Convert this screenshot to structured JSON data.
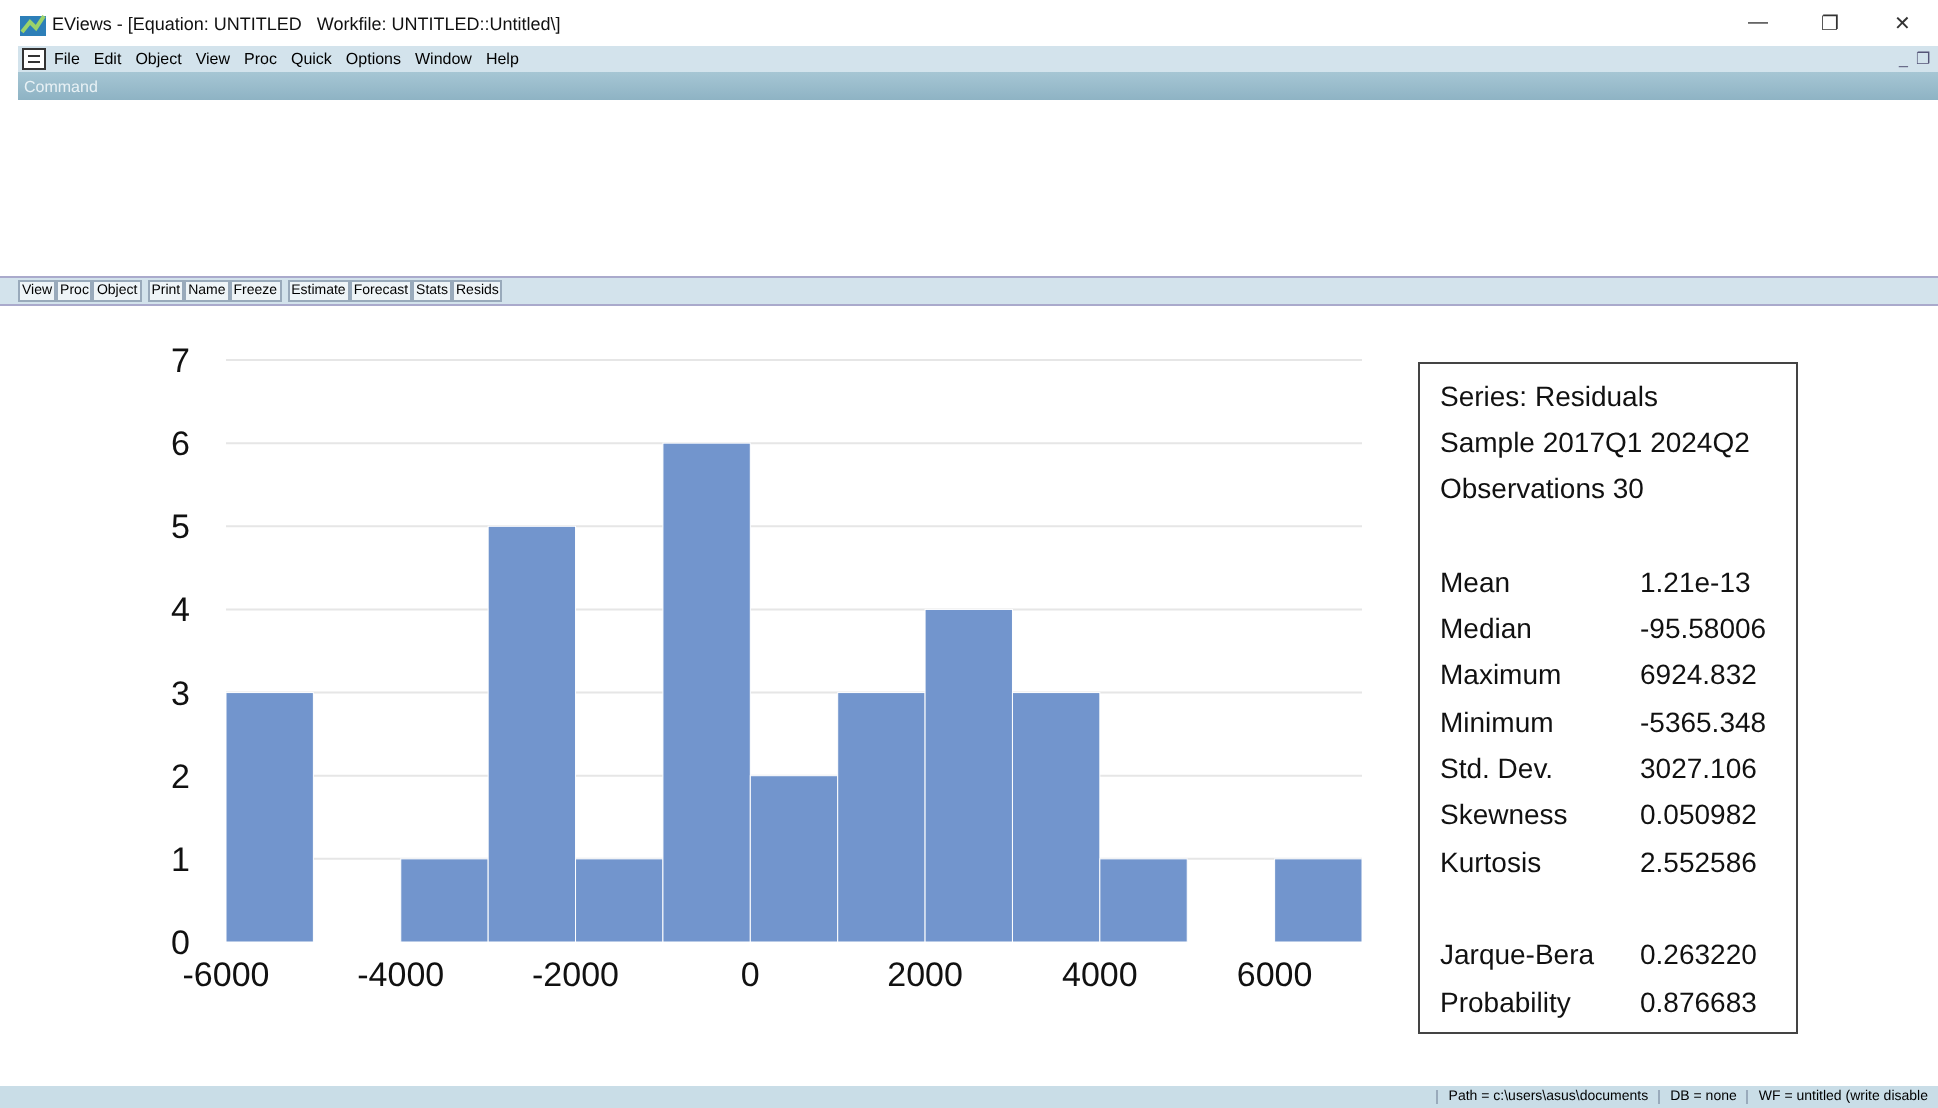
{
  "window": {
    "title": "EViews - [Equation: UNTITLED   Workfile: UNTITLED::Untitled\\]",
    "controls": [
      "—",
      "❐",
      "✕"
    ]
  },
  "menu": {
    "items": [
      "File",
      "Edit",
      "Object",
      "View",
      "Proc",
      "Quick",
      "Options",
      "Window",
      "Help"
    ],
    "mdi_controls": [
      "_",
      "❐"
    ]
  },
  "command": {
    "label": "Command"
  },
  "toolbar": {
    "groups": [
      [
        "View",
        "Proc",
        "Object"
      ],
      [
        "Print",
        "Name",
        "Freeze"
      ],
      [
        "Estimate",
        "Forecast",
        "Stats",
        "Resids"
      ]
    ]
  },
  "chart": {
    "chart_data": {
      "type": "bar",
      "x": [
        -5500,
        -4500,
        -3500,
        -2500,
        -1500,
        -500,
        500,
        1500,
        2500,
        3500,
        4500,
        5500,
        6500
      ],
      "grid": true,
      "series": [
        {
          "color": "#7295cd",
          "values": [
            3,
            0,
            1,
            5,
            1,
            6,
            2,
            3,
            4,
            3,
            1,
            0,
            1
          ]
        }
      ],
      "xlim": [
        -6000,
        7000
      ],
      "ylim": [
        0,
        7
      ],
      "xticks": [
        -6000,
        -4000,
        -2000,
        0,
        2000,
        4000,
        6000
      ],
      "yticks": [
        0,
        1,
        2,
        3,
        4,
        5,
        6,
        7
      ]
    }
  },
  "stats": {
    "header": [
      "Series: Residuals",
      "Sample 2017Q1 2024Q2",
      "Observations 30"
    ],
    "groups": [
      [
        {
          "label": "Mean",
          "value": "1.21e-13"
        },
        {
          "label": "Median",
          "value": "-95.58006"
        },
        {
          "label": "Maximum",
          "value": "6924.832"
        },
        {
          "label": "Minimum",
          "value": "-5365.348"
        },
        {
          "label": "Std. Dev.",
          "value": "3027.106"
        },
        {
          "label": "Skewness",
          "value": "0.050982"
        },
        {
          "label": "Kurtosis",
          "value": "2.552586"
        }
      ],
      [
        {
          "label": "Jarque-Bera",
          "value": "0.263220"
        },
        {
          "label": "Probability",
          "value": "0.876683"
        }
      ]
    ]
  },
  "status_bar": [
    "Path = c:\\users\\asus\\documents",
    "DB = none",
    "WF = untitled (write disable"
  ]
}
